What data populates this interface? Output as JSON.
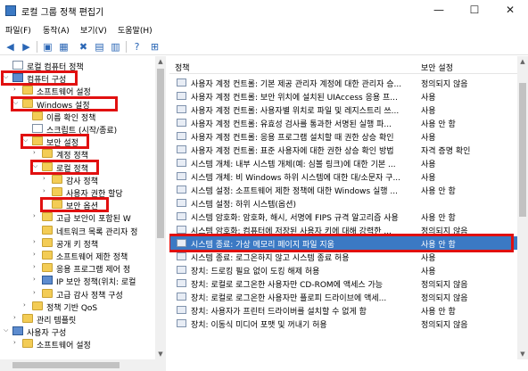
{
  "window": {
    "title": "로컬 그룹 정책 편집기",
    "min_glyph": "—",
    "max_glyph": "☐",
    "close_glyph": "✕"
  },
  "menu": [
    "파일(F)",
    "동작(A)",
    "보기(V)",
    "도움말(H)"
  ],
  "toolbar": {
    "icons": [
      "back-icon",
      "forward-icon",
      "folder-up-icon",
      "show-tree-icon",
      "delete-icon",
      "properties-icon",
      "export-list-icon",
      "help-icon",
      "filter-icon"
    ],
    "glyphs": [
      "◀",
      "▶",
      "▣",
      "▦",
      "✖",
      "▤",
      "▥",
      "?",
      "⊞"
    ]
  },
  "tree": [
    {
      "name": "tree-local-computer-policy",
      "label": "로컬 컴퓨터 정책",
      "level": 0,
      "icon": "doc",
      "exp": ""
    },
    {
      "name": "tree-computer-config",
      "label": "컴퓨터 구성",
      "level": 0,
      "icon": "pc",
      "exp": "⌵",
      "highlight": true
    },
    {
      "name": "tree-software-settings",
      "label": "소프트웨어 설정",
      "level": 1,
      "icon": "folder",
      "exp": "›"
    },
    {
      "name": "tree-windows-settings",
      "label": "Windows 설정",
      "level": 1,
      "icon": "folder",
      "exp": "⌵",
      "highlight": true
    },
    {
      "name": "tree-name-resolution",
      "label": "이름 확인 정책",
      "level": 2,
      "icon": "folder",
      "exp": ""
    },
    {
      "name": "tree-scripts",
      "label": "스크립트 (시작/종료)",
      "level": 2,
      "icon": "doc",
      "exp": ""
    },
    {
      "name": "tree-security-settings",
      "label": "보안 설정",
      "level": 2,
      "icon": "key",
      "exp": "⌵",
      "highlight": true
    },
    {
      "name": "tree-account-policies",
      "label": "계정 정책",
      "level": 3,
      "icon": "folder",
      "exp": "›"
    },
    {
      "name": "tree-local-policies",
      "label": "로컬 정책",
      "level": 3,
      "icon": "folder",
      "exp": "⌵",
      "highlight": true
    },
    {
      "name": "tree-audit-policy",
      "label": "감사 정책",
      "level": 4,
      "icon": "folder",
      "exp": "›"
    },
    {
      "name": "tree-user-rights",
      "label": "사용자 권한 할당",
      "level": 4,
      "icon": "folder",
      "exp": "›"
    },
    {
      "name": "tree-security-options",
      "label": "보안 옵션",
      "level": 4,
      "icon": "folder",
      "exp": "",
      "highlight": true
    },
    {
      "name": "tree-advanced-firewall",
      "label": "고급 보안이 포함된 W",
      "level": 3,
      "icon": "folder",
      "exp": "›"
    },
    {
      "name": "tree-network-list",
      "label": "네트워크 목록 관리자 정",
      "level": 3,
      "icon": "folder",
      "exp": ""
    },
    {
      "name": "tree-public-key",
      "label": "공개 키 정책",
      "level": 3,
      "icon": "folder",
      "exp": "›"
    },
    {
      "name": "tree-software-restriction",
      "label": "소프트웨어 제한 정책",
      "level": 3,
      "icon": "folder",
      "exp": "›"
    },
    {
      "name": "tree-app-control",
      "label": "응용 프로그램 제어 정",
      "level": 3,
      "icon": "folder",
      "exp": "›"
    },
    {
      "name": "tree-ip-security",
      "label": "IP 보안 정책(위치: 로컬",
      "level": 3,
      "icon": "pc",
      "exp": "›"
    },
    {
      "name": "tree-advanced-audit",
      "label": "고급 감사 정책 구성",
      "level": 3,
      "icon": "folder",
      "exp": "›"
    },
    {
      "name": "tree-policy-qos",
      "label": "정책 기반 QoS",
      "level": 2,
      "icon": "folder",
      "exp": "›"
    },
    {
      "name": "tree-admin-templates",
      "label": "관리 템플릿",
      "level": 1,
      "icon": "folder",
      "exp": "›"
    },
    {
      "name": "tree-user-config",
      "label": "사용자 구성",
      "level": 0,
      "icon": "pc",
      "exp": "⌵"
    },
    {
      "name": "tree-user-software-settings",
      "label": "소프트웨어 설정",
      "level": 1,
      "icon": "folder",
      "exp": "›"
    }
  ],
  "list": {
    "col_policy": "정책",
    "col_setting": "보안 설정",
    "rows": [
      {
        "policy": "사용자 계정 컨트롤: 기본 제공 관리자 계정에 대한 관리자 승...",
        "setting": "정의되지 않음"
      },
      {
        "policy": "사용자 계정 컨트롤: 보안 위치에 설치된 UIAccess 응용 프...",
        "setting": "사용"
      },
      {
        "policy": "사용자 계정 컨트롤: 사용자별 위치로 파일 및 레지스트리 쓰...",
        "setting": "사용"
      },
      {
        "policy": "사용자 계정 컨트롤: 유효성 검사를 통과한 서명된 실행 파...",
        "setting": "사용 안 함"
      },
      {
        "policy": "사용자 계정 컨트롤: 응용 프로그램 설치할 때 권한 상승 확인",
        "setting": "사용"
      },
      {
        "policy": "사용자 계정 컨트롤: 표준 사용자에 대한 권한 상승 확인 방법",
        "setting": "자격 증명 확인"
      },
      {
        "policy": "시스템 개체: 내부 시스템 개체(예: 심볼 링크)에 대한 기본 ...",
        "setting": "사용"
      },
      {
        "policy": "시스템 개체: 비 Windows 하위 시스템에 대한 대/소문자 구...",
        "setting": "사용"
      },
      {
        "policy": "시스템 설정: 소프트웨어 제한 정책에 대한 Windows 실행 ...",
        "setting": "사용 안 함"
      },
      {
        "policy": "시스템 설정: 하위 시스템(옵션)",
        "setting": ""
      },
      {
        "policy": "시스템 암호화: 암호화, 해시, 서명에 FIPS 규격 알고리즘 사용",
        "setting": "사용 안 함"
      },
      {
        "policy": "시스템 암호화: 컴퓨터에 저장된 사용자 키에 대해 강력한 ...",
        "setting": "정의되지 않음"
      },
      {
        "policy": "시스템 종료: 가상 메모리 페이지 파일 지움",
        "setting": "사용 안 함",
        "selected": true
      },
      {
        "policy": "시스템 종료: 로그온하지 않고 시스템 종료 허용",
        "setting": "사용"
      },
      {
        "policy": "장치: 드로킹 필요 없이 도킹 해제 허용",
        "setting": "사용"
      },
      {
        "policy": "장치: 로컬로 로그온한 사용자만 CD-ROM에 액세스 가능",
        "setting": "정의되지 않음"
      },
      {
        "policy": "장치: 로컬로 로그온한 사용자만 플로피 드라이브에 액세...",
        "setting": "정의되지 않음"
      },
      {
        "policy": "장치: 사용자가 프린터 드라이버를 설치할 수 없게 함",
        "setting": "사용 안 함"
      },
      {
        "policy": "장치: 이동식 미디어 포맷 및 꺼내기 허용",
        "setting": "정의되지 않음"
      }
    ]
  }
}
